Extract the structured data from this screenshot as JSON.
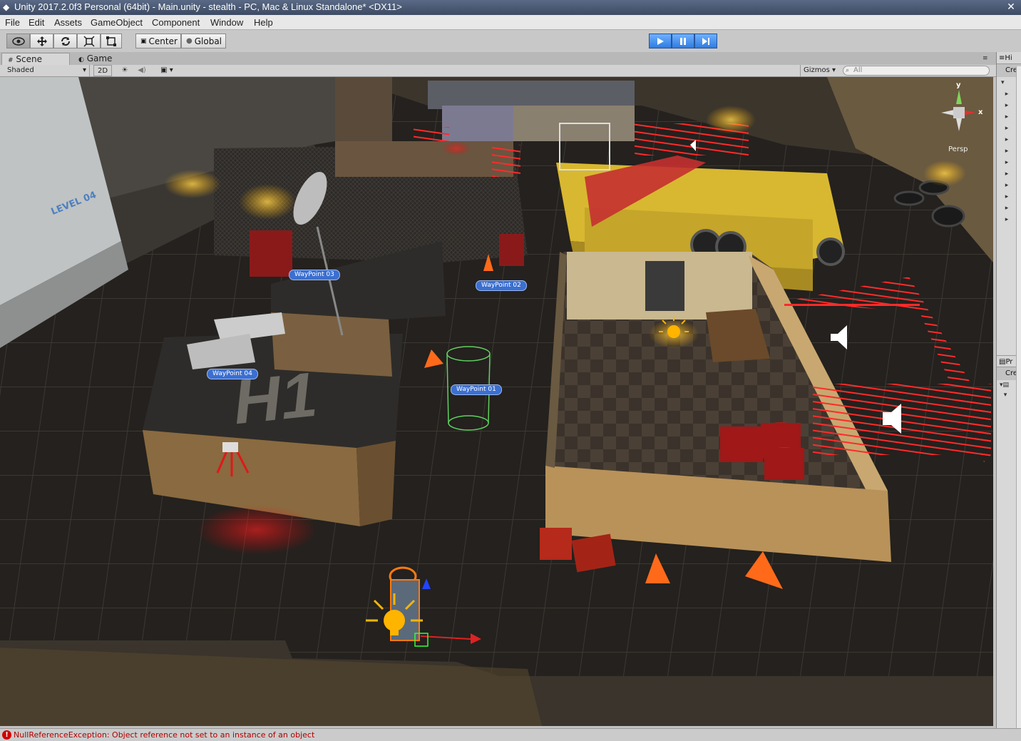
{
  "window": {
    "title": "Unity 2017.2.0f3 Personal (64bit) - Main.unity - stealth - PC, Mac & Linux Standalone* <DX11>",
    "close": "✕"
  },
  "menu": [
    "File",
    "Edit",
    "Assets",
    "GameObject",
    "Component",
    "Window",
    "Help"
  ],
  "toolbar": {
    "pivot_label": "Center",
    "space_label": "Global"
  },
  "tabs": {
    "scene": "Scene",
    "game": "Game"
  },
  "scene_toolbar": {
    "shading_mode": "Shaded",
    "mode_2d": "2D",
    "gizmos": "Gizmos",
    "search_placeholder": "All"
  },
  "viewport": {
    "projection": "Persp",
    "axis_y": "y",
    "axis_x": "x"
  },
  "waypoints": [
    "WayPoint 03",
    "WayPoint 02",
    "WayPoint 04",
    "WayPoint 01"
  ],
  "map_text": {
    "level_sign": "LEVEL 04",
    "helipad": "H1"
  },
  "hierarchy": {
    "tab": "Hi",
    "create": "Crea"
  },
  "project": {
    "tab": "Pr",
    "create": "Crea"
  },
  "status": {
    "message": "NullReferenceException: Object reference not set to an instance of an object",
    "icon": "error-icon"
  },
  "colors": {
    "play_accent": "#2f7ce0",
    "waypoint": "#3b6fd0",
    "laser": "#ff2a2a",
    "error": "#d00000"
  }
}
